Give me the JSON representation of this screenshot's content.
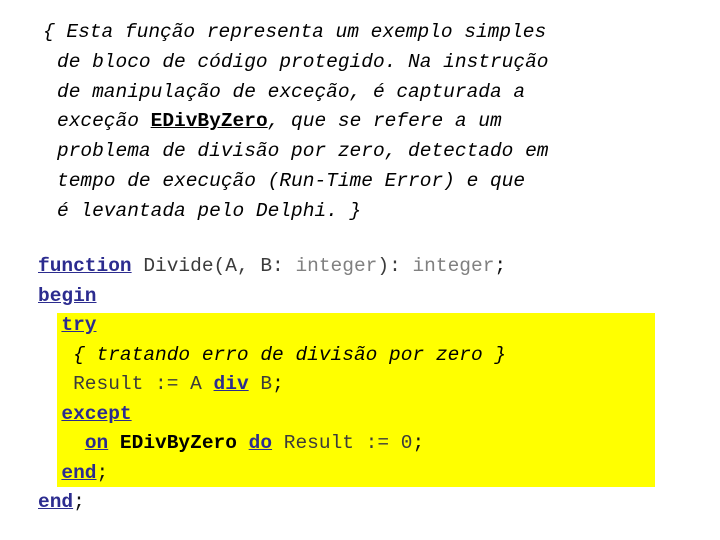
{
  "slide": {
    "background_color": "#ffffff",
    "highlight_color": "#ffff00",
    "keyword_color": "#2c2c8f",
    "type_color": "#808080",
    "text_color": "#000000"
  },
  "comment_block": {
    "lines": [
      {
        "pre": "{ Esta função representa um exemplo simples",
        "strong": "",
        "post": ""
      },
      {
        "pre": "de bloco de código protegido. Na instrução",
        "strong": "",
        "post": ""
      },
      {
        "pre": "de manipulação de exceção, é capturada a",
        "strong": "",
        "post": ""
      },
      {
        "pre": "exceção ",
        "strong": "EDivByZero",
        "post": ", que se refere a um"
      },
      {
        "pre": "problema de divisão por zero, detectado em",
        "strong": "",
        "post": ""
      },
      {
        "pre": "tempo de execução (Run-Time Error) e que",
        "strong": "",
        "post": ""
      },
      {
        "pre": "é levantada pelo Delphi. }",
        "strong": "",
        "post": ""
      }
    ]
  },
  "code_block": {
    "language": "Pascal/Delphi",
    "lines": [
      {
        "indent": "",
        "tokens": [
          {
            "text": "function",
            "kind": "keyword"
          },
          {
            "text": " Divide(A, B: ",
            "kind": "plain"
          },
          {
            "text": "integer",
            "kind": "type"
          },
          {
            "text": "): ",
            "kind": "plain"
          },
          {
            "text": "integer",
            "kind": "type"
          },
          {
            "text": ";",
            "kind": "dark"
          }
        ]
      },
      {
        "indent": "",
        "tokens": [
          {
            "text": "begin",
            "kind": "keyword"
          }
        ]
      },
      {
        "indent": "  ",
        "tokens": [
          {
            "text": "try",
            "kind": "keyword"
          }
        ]
      },
      {
        "indent": "   ",
        "tokens": [
          {
            "text": "{ tratando erro de divisão por zero }",
            "kind": "comment"
          }
        ]
      },
      {
        "indent": "   ",
        "tokens": [
          {
            "text": "Result := A ",
            "kind": "plain"
          },
          {
            "text": "div",
            "kind": "keyword"
          },
          {
            "text": " B",
            "kind": "plain"
          },
          {
            "text": ";",
            "kind": "dark"
          }
        ]
      },
      {
        "indent": "  ",
        "tokens": [
          {
            "text": "except",
            "kind": "keyword"
          }
        ]
      },
      {
        "indent": "    ",
        "tokens": [
          {
            "text": "on",
            "kind": "keyword"
          },
          {
            "text": " ",
            "kind": "plain"
          },
          {
            "text": "EDivByZero",
            "kind": "ident-bold"
          },
          {
            "text": " ",
            "kind": "plain"
          },
          {
            "text": "do",
            "kind": "keyword"
          },
          {
            "text": " Result := 0",
            "kind": "plain"
          },
          {
            "text": ";",
            "kind": "dark"
          }
        ]
      },
      {
        "indent": "  ",
        "tokens": [
          {
            "text": "end",
            "kind": "keyword"
          },
          {
            "text": ";",
            "kind": "dark"
          }
        ]
      },
      {
        "indent": "",
        "tokens": [
          {
            "text": "end",
            "kind": "keyword"
          },
          {
            "text": ";",
            "kind": "dark"
          }
        ]
      }
    ]
  }
}
